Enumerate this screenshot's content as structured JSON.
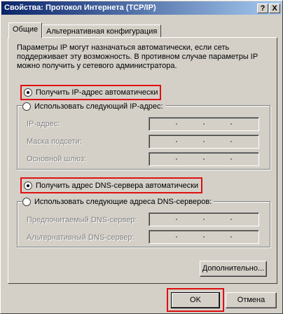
{
  "window": {
    "title": "Свойства: Протокол Интернета (TCP/IP)",
    "help_glyph": "?",
    "close_glyph": "X"
  },
  "tabs": [
    {
      "label": "Общие",
      "active": true
    },
    {
      "label": "Альтернативная конфигурация",
      "active": false
    }
  ],
  "description": "Параметры IP могут назначаться автоматически, если сеть поддерживает эту возможность. В противном случае параметры IP можно получить у сетевого администратора.",
  "ip": {
    "auto_label": "Получить IP-адрес автоматически",
    "manual_label": "Использовать следующий IP-адрес:",
    "auto_selected": true,
    "fields": [
      {
        "label": "IP-адрес:",
        "value": ""
      },
      {
        "label": "Маска подсети:",
        "value": ""
      },
      {
        "label": "Основной шлюз:",
        "value": ""
      }
    ]
  },
  "dns": {
    "auto_label": "Получить адрес DNS-сервера автоматически",
    "manual_label": "Использовать следующие адреса DNS-серверов:",
    "auto_selected": true,
    "fields": [
      {
        "label": "Предпочитаемый DNS-сервер:",
        "value": ""
      },
      {
        "label": "Альтернативный DNS-сервер:",
        "value": ""
      }
    ]
  },
  "buttons": {
    "advanced": "Дополнительно...",
    "ok": "OK",
    "cancel": "Отмена"
  },
  "colors": {
    "highlight": "#e01010",
    "titlebar_start": "#0a246a",
    "titlebar_end": "#a6caf0"
  }
}
